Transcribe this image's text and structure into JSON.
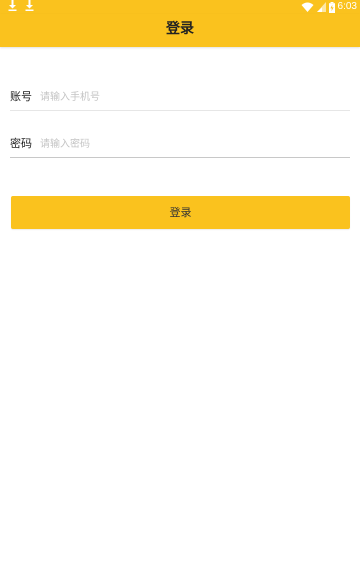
{
  "status_bar": {
    "time": "6:03",
    "icons": [
      "download-icon",
      "download-icon",
      "wifi-icon",
      "signal-icon",
      "battery-icon"
    ],
    "background_color": "#fac21e"
  },
  "header": {
    "title": "登录",
    "background_color": "#fac21e"
  },
  "form": {
    "account": {
      "label": "账号",
      "placeholder": "请输入手机号",
      "value": ""
    },
    "password": {
      "label": "密码",
      "placeholder": "请输入密码",
      "value": ""
    },
    "submit_label": "登录"
  },
  "colors": {
    "accent": "#fac21e",
    "text": "#222222",
    "placeholder": "#c4c4c4"
  }
}
